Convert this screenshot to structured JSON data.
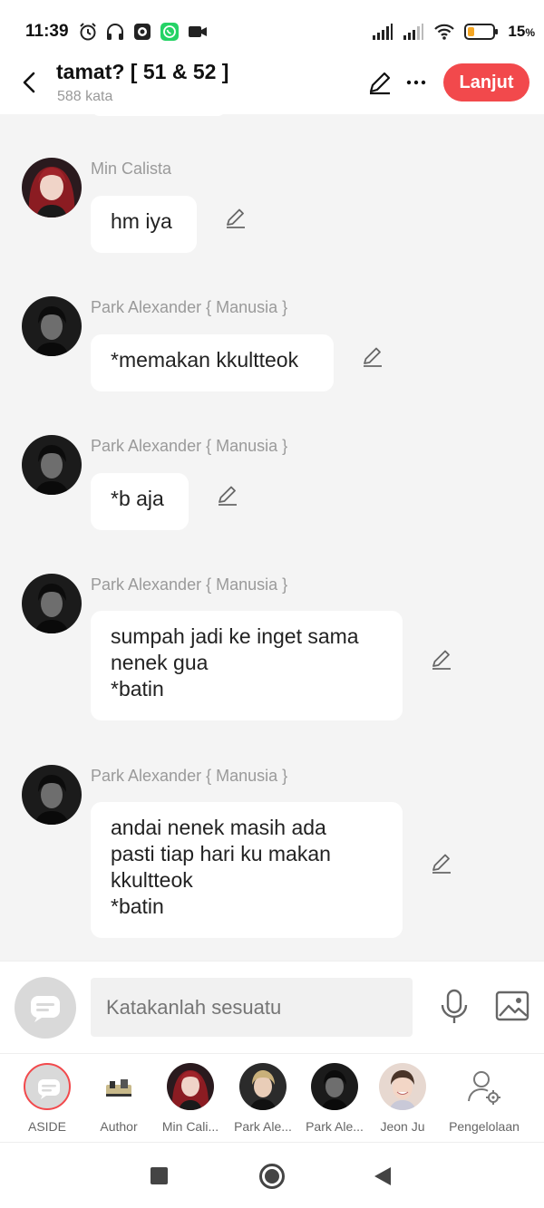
{
  "status_bar": {
    "time": "11:39",
    "battery": "15",
    "battery_suffix": "%",
    "icons_left": [
      "alarm-icon",
      "headphones-icon",
      "record-icon",
      "whatsapp-icon",
      "video-camera-icon"
    ],
    "icons_right": [
      "signal-icon",
      "signal-icon",
      "wifi-icon",
      "battery-icon"
    ]
  },
  "header": {
    "title": "tamat? [ 51 & 52 ]",
    "subtitle": "588 kata",
    "continue_label": "Lanjut"
  },
  "messages": [
    {
      "sender": "Min Calista",
      "text": "hm iya",
      "avatar": "min-calista"
    },
    {
      "sender": "Park Alexander { Manusia }",
      "text": "*memakan kkultteok",
      "avatar": "park-alexander"
    },
    {
      "sender": "Park Alexander { Manusia }",
      "text": "*b aja",
      "avatar": "park-alexander"
    },
    {
      "sender": "Park Alexander { Manusia }",
      "text": "sumpah jadi ke inget sama\nnenek gua\n*batin",
      "avatar": "park-alexander"
    },
    {
      "sender": "Park Alexander { Manusia }",
      "text": "andai nenek masih ada\npasti tiap hari ku makan\nkkultteok\n*batin",
      "avatar": "park-alexander"
    }
  ],
  "composer": {
    "placeholder": "Katakanlah sesuatu"
  },
  "characters": [
    {
      "name": "ASIDE"
    },
    {
      "name": "Author"
    },
    {
      "name": "Min Cali..."
    },
    {
      "name": "Park Ale..."
    },
    {
      "name": "Park Ale..."
    },
    {
      "name": "Jeon Ju"
    },
    {
      "name": "Pengelolaan"
    }
  ],
  "colors": {
    "accent": "#f2494c",
    "background": "#f4f4f4",
    "bubble": "#ffffff",
    "sender_text": "#9a9a9a"
  }
}
